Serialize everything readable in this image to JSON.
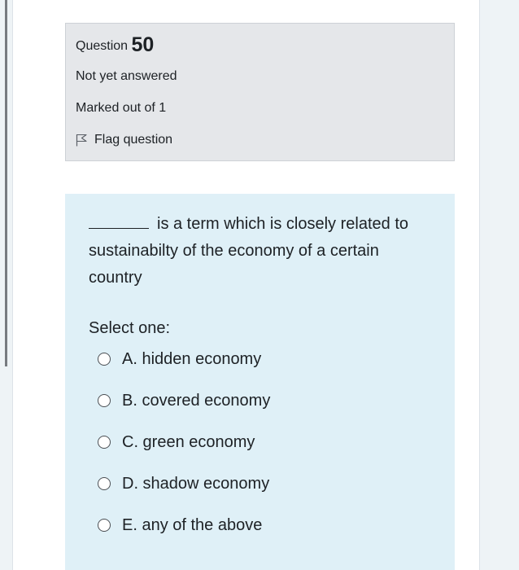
{
  "question": {
    "label": "Question",
    "number": "50",
    "state": "Not yet answered",
    "grade": "Marked out of 1",
    "flag_label": "Flag question"
  },
  "formulation": {
    "question_text": "is a term which is closely related to sustainabilty of the economy of a certain country",
    "prompt": "Select one:",
    "options": [
      {
        "label": "A. hidden economy"
      },
      {
        "label": "B. covered economy"
      },
      {
        "label": "C. green economy"
      },
      {
        "label": "D. shadow economy"
      },
      {
        "label": "E. any of the above"
      }
    ]
  },
  "colors": {
    "info_background": "#e5e7ea",
    "formulation_background": "#dff0f7",
    "text": "#1d2125"
  },
  "icons": {
    "flag": "flag-icon",
    "radio": "radio-icon"
  }
}
